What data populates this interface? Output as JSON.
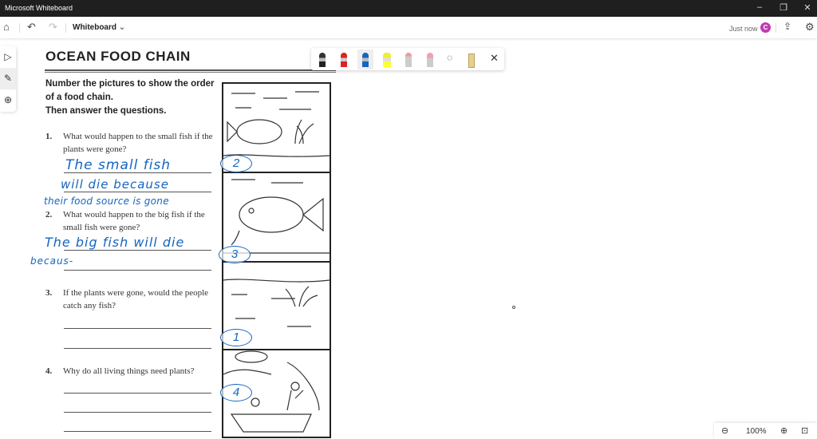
{
  "window": {
    "title": "Microsoft Whiteboard",
    "minimize": "–",
    "restore": "❐",
    "close": "✕"
  },
  "topbar": {
    "board_name": "Whiteboard",
    "status": "Just now",
    "avatar_letter": "C"
  },
  "worksheet": {
    "title": "OCEAN FOOD CHAIN",
    "instructions": [
      "Number the pictures to show the order",
      "of a food chain.",
      "Then answer the questions."
    ],
    "questions": [
      {
        "num": "1.",
        "text": "What would happen to the small fish if the plants were gone?"
      },
      {
        "num": "2.",
        "text": "What would happen to the big fish if the small fish were gone?"
      },
      {
        "num": "3.",
        "text": "If the plants were gone, would the people catch any fish?"
      },
      {
        "num": "4.",
        "text": "Why do all living things need plants?"
      }
    ]
  },
  "ink": {
    "answer1": [
      "The small fish",
      "will die because",
      "their food source is gone"
    ],
    "answer2": [
      "The big fish will die",
      "becaus-"
    ],
    "circled_numbers": [
      "2",
      "3",
      "1",
      "4"
    ]
  },
  "zoom": {
    "level": "100%"
  }
}
